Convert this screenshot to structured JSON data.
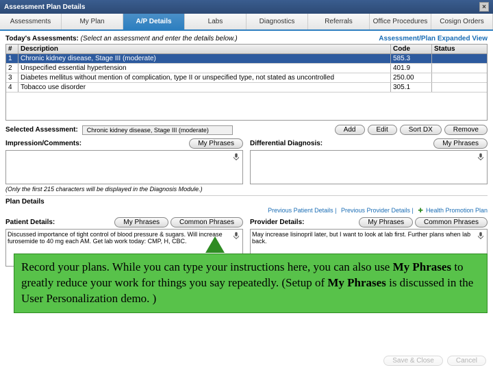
{
  "window": {
    "title": "Assessment Plan Details"
  },
  "tabs": [
    "Assessments",
    "My Plan",
    "A/P Details",
    "Labs",
    "Diagnostics",
    "Referrals",
    "Office Procedures",
    "Cosign Orders"
  ],
  "active_tab": 2,
  "todays_assessments": {
    "label": "Today's Assessments:",
    "note": "(Select an assessment and enter the details below.)",
    "expanded_link": "Assessment/Plan Expanded View"
  },
  "grid": {
    "headers": {
      "num": "#",
      "desc": "Description",
      "code": "Code",
      "status": "Status"
    },
    "rows": [
      {
        "n": "1",
        "desc": "Chronic kidney disease, Stage III (moderate)",
        "code": "585.3",
        "status": ""
      },
      {
        "n": "2",
        "desc": "Unspecified essential hypertension",
        "code": "401.9",
        "status": ""
      },
      {
        "n": "3",
        "desc": "Diabetes mellitus without mention of complication, type II or unspecified type, not stated as uncontrolled",
        "code": "250.00",
        "status": ""
      },
      {
        "n": "4",
        "desc": "Tobacco use disorder",
        "code": "305.1",
        "status": ""
      }
    ]
  },
  "selected_assessment": {
    "label": "Selected Assessment:",
    "value": "Chronic kidney disease, Stage III (moderate)"
  },
  "action_buttons": {
    "add": "Add",
    "edit": "Edit",
    "sort": "Sort DX",
    "remove": "Remove"
  },
  "impression": {
    "label": "Impression/Comments:",
    "myphrases": "My Phrases"
  },
  "differential": {
    "label": "Differential Diagnosis:",
    "myphrases": "My Phrases"
  },
  "char_note": "(Only the first 215 characters will be displayed in the Diagnosis Module.)",
  "plan_details_label": "Plan Details",
  "links": {
    "prev_patient": "Previous Patient Details",
    "prev_provider": "Previous Provider Details",
    "health_promo": "Health Promotion Plan"
  },
  "patient_details": {
    "label": "Patient Details:",
    "myphrases": "My Phrases",
    "common": "Common Phrases",
    "text": "Discussed importance of tight control of blood pressure & sugars. Will increase furosemide to 40 mg each AM. Get lab work today: CMP, H, CBC."
  },
  "provider_details": {
    "label": "Provider Details:",
    "myphrases": "My Phrases",
    "common": "Common Phrases",
    "text": "May increase lisinopril later, but I want to look at lab first. Further plans when lab back."
  },
  "footer": {
    "save": "Save & Close",
    "cancel": "Cancel"
  },
  "tooltip": {
    "t1": "Record your plans.  While you can type your instructions here, you can also use ",
    "b1": "My Phrases",
    "t2": " to greatly reduce your work for things you say repeatedly.  (Setup of ",
    "b2": "My Phrases",
    "t3": " is discussed in the User Personalization demo. )"
  }
}
